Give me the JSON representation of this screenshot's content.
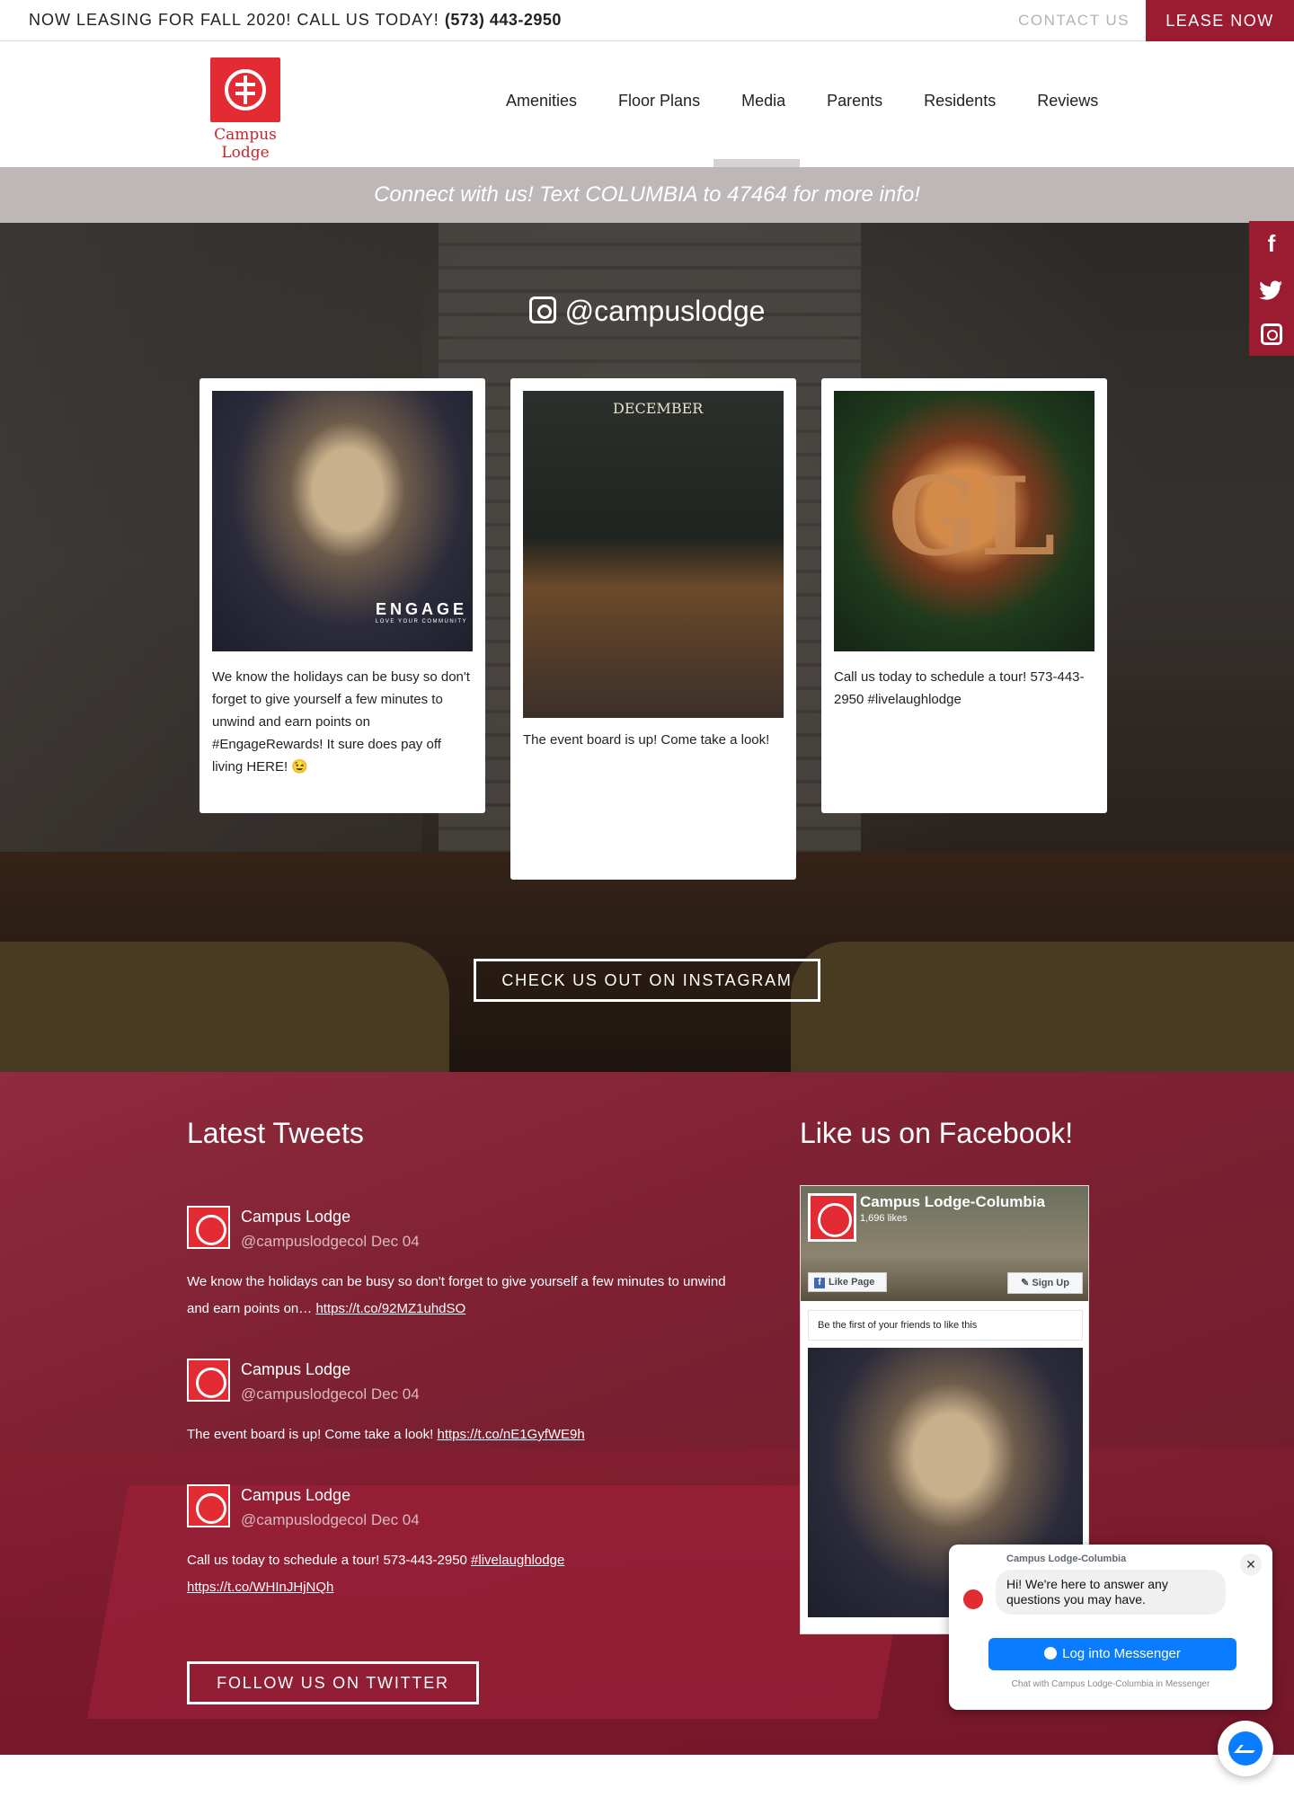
{
  "topbar": {
    "leasing_text": "NOW LEASING FOR FALL 2020! CALL US TODAY!",
    "phone": "(573) 443-2950",
    "contact_label": "CONTACT US",
    "lease_label": "LEASE NOW"
  },
  "header": {
    "logo_name": "Campus Lodge",
    "nav": [
      "Amenities",
      "Floor Plans",
      "Media",
      "Parents",
      "Residents",
      "Reviews"
    ]
  },
  "connect_text": "Connect with us! Text COLUMBIA to 47464 for more info!",
  "instagram": {
    "handle": "@campuslodge",
    "posts": [
      {
        "caption": "We know the holidays can be busy so don't forget to give yourself a few minutes to unwind and earn points on #EngageRewards! It sure does pay off living HERE! 😉",
        "overlay": "ENGAGE",
        "overlay_sub": "LOVE YOUR COMMUNITY"
      },
      {
        "caption": "The event board is up! Come take a look!",
        "overlay": "DECEMBER"
      },
      {
        "caption": "Call us today to schedule a tour! 573-443-2950 #livelaughlodge",
        "overlay": "GL"
      }
    ],
    "button_label": "CHECK US OUT ON INSTAGRAM"
  },
  "social": {
    "facebook": "f",
    "twitter": "t",
    "instagram": "ig"
  },
  "tweets": {
    "title": "Latest Tweets",
    "items": [
      {
        "name": "Campus Lodge",
        "handle": "@campuslodgecol Dec 04",
        "text": "We know the holidays can be busy so don't forget to give yourself a few minutes to unwind and earn points on… ",
        "link": "https://t.co/92MZ1uhdSO"
      },
      {
        "name": "Campus Lodge",
        "handle": "@campuslodgecol Dec 04",
        "text": "The event board is up! Come take a look! ",
        "link": "https://t.co/nE1GyfWE9h"
      },
      {
        "name": "Campus Lodge",
        "handle": "@campuslodgecol Dec 04",
        "text": "Call us today to schedule a tour! 573-443-2950 ",
        "hashtag": "#livelaughlodge",
        "link": "https://t.co/WHInJHjNQh"
      }
    ],
    "button_label": "FOLLOW US ON TWITTER"
  },
  "facebook": {
    "title": "Like us on Facebook!",
    "page_name": "Campus Lodge-Columbia",
    "likes": "1,696 likes",
    "like_label": "Like Page",
    "signup_label": "Sign Up",
    "friends_text": "Be the first of your friends to like this"
  },
  "messenger": {
    "from": "Campus Lodge-Columbia",
    "message": "Hi! We're here to answer any questions you may have.",
    "login_label": "Log into Messenger",
    "footer": "Chat with Campus Lodge-Columbia in Messenger",
    "close_glyph": "✕"
  }
}
